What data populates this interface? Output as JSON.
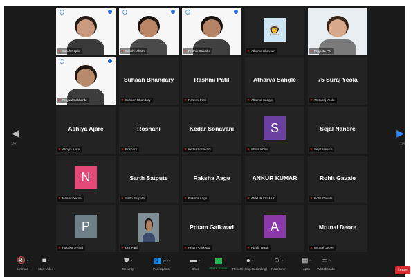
{
  "colors": {
    "background": "#1a1a1a",
    "tile": "#232323",
    "speaker_outline": "#b6d94a",
    "leave": "#d9292f",
    "mic_muted": "#e0312f"
  },
  "tiles": [
    {
      "kind": "photo",
      "tag": "Sarah Pople"
    },
    {
      "kind": "photo",
      "tag": "Sakshi Mhatre"
    },
    {
      "kind": "photo",
      "tag": "Prathik Salunke"
    },
    {
      "kind": "avatar",
      "icon": "astronaut-icon",
      "tag": "Atharva Bhavsar"
    },
    {
      "kind": "photo",
      "tag": "Prajakta Pol",
      "speaking": true
    },
    {
      "kind": "photo",
      "tag": "Prajwal Sakharde"
    },
    {
      "kind": "name",
      "name": "Suhaan Bhandary",
      "tag": "Suhaan Bhandary"
    },
    {
      "kind": "name",
      "name": "Rashmi Patil",
      "tag": "Rashmi Patil"
    },
    {
      "kind": "name",
      "name": "Atharva Sangle",
      "tag": "Atharva Sangle"
    },
    {
      "kind": "name",
      "name": "75 Suraj Yeola",
      "tag": "75 Suraj Yeola"
    },
    {
      "kind": "name",
      "name": "Ashiya Ajare",
      "tag": "Ashiya Ajare"
    },
    {
      "kind": "name",
      "name": "Roshani",
      "tag": "Roshani"
    },
    {
      "kind": "name",
      "name": "Kedar Sonavani",
      "tag": "Kedar Sonavani"
    },
    {
      "kind": "letter",
      "letter": "S",
      "color": "#6a3fa0",
      "tag": "Shruti Khire"
    },
    {
      "kind": "name",
      "name": "Sejal Nandre",
      "tag": "Sejal Nandre"
    },
    {
      "kind": "letter",
      "letter": "N",
      "color": "#e34a77",
      "tag": "Naman Yerne"
    },
    {
      "kind": "name",
      "name": "Sarth Satpute",
      "tag": "Sarth Satpute"
    },
    {
      "kind": "name",
      "name": "Raksha Aage",
      "tag": "Raksha Aage"
    },
    {
      "kind": "name",
      "name": "ANKUR KUMAR",
      "tag": "ANKUR KUMAR"
    },
    {
      "kind": "name",
      "name": "Rohit Gavale",
      "tag": "Rohit Gavale"
    },
    {
      "kind": "letter",
      "letter": "P",
      "color": "#6e7f87",
      "tag": "Pushkaj Avhad"
    },
    {
      "kind": "photo",
      "tag": "Om Patil"
    },
    {
      "kind": "name",
      "name": "Pritam Gaikwad",
      "tag": "Pritam Gaikwad"
    },
    {
      "kind": "letter",
      "letter": "A",
      "color": "#8a3aa8",
      "tag": "Abhijit Wagh"
    },
    {
      "kind": "name",
      "name": "Mrunal Deore",
      "tag": "Mrunal Deore"
    }
  ],
  "pager": {
    "left": "1/4",
    "right": "1/4"
  },
  "toolbar": [
    {
      "icon": "mic-off-icon",
      "label": "Unmute"
    },
    {
      "icon": "video-off-icon",
      "label": "Start Video"
    },
    {
      "icon": "shield-icon",
      "label": "Security"
    },
    {
      "icon": "participants-icon",
      "label": "Participants",
      "count": "91"
    },
    {
      "icon": "chat-icon",
      "label": "Chat"
    },
    {
      "icon": "share-screen-icon",
      "label": "Share Screen"
    },
    {
      "icon": "record-icon",
      "label": "Record (Stop Recording)"
    },
    {
      "icon": "reactions-icon",
      "label": "Reactions"
    },
    {
      "icon": "apps-icon",
      "label": "Apps"
    },
    {
      "icon": "whiteboards-icon",
      "label": "Whiteboards"
    }
  ],
  "leave_label": "Leave"
}
